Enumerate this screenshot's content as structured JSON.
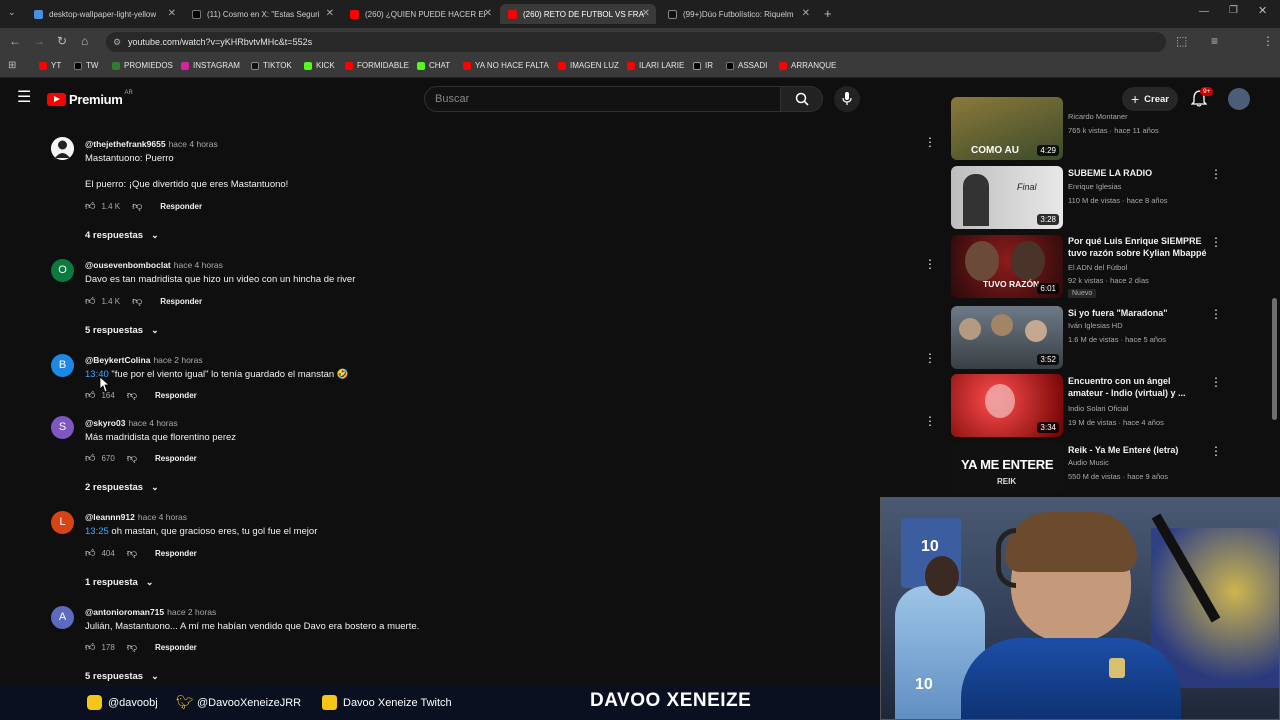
{
  "browser": {
    "tabs": [
      {
        "title": "desktop-wallpaper-light-yellow"
      },
      {
        "title": "(11) Cosmo en X: \"Estas Seguri"
      },
      {
        "title": "(260) ¿QUIEN PUEDE HACER El"
      },
      {
        "title": "(260) RETO DE FUTBOL VS FRA"
      },
      {
        "title": "(99+)Dúo Futbolístico: Riquelm"
      }
    ],
    "url": "youtube.com/watch?v=yKHRbvtvMHc&t=552s",
    "bookmarks": [
      "YT",
      "TW",
      "PROMIEDOS",
      "INSTAGRAM",
      "TIKTOK",
      "KICK",
      "FORMIDABLE",
      "CHAT",
      "YA NO HACE FALTA",
      "IMAGEN LUZ",
      "ILARI LARIE",
      "IR",
      "ASSADI",
      "ARRANQUE"
    ]
  },
  "youtube": {
    "logo": "Premium",
    "region": "AR",
    "search_placeholder": "Buscar",
    "create_label": "Crear",
    "notif_badge": "9+"
  },
  "comments": [
    {
      "author": "@thejethefrank9655",
      "time": "hace 4 horas",
      "avatar_letter": "",
      "avatar_color": "#ffffff",
      "text": "Mastantuono: Puerro",
      "text2": "El puerro: ¡Que divertido que eres Mastantuono!",
      "likes": "1.4 K",
      "reply": "Responder",
      "replies": "4 respuestas"
    },
    {
      "author": "@ousevenbomboclat",
      "time": "hace 4 horas",
      "avatar_letter": "O",
      "avatar_color": "#0b7a3e",
      "text": "Davo es tan madridista que hizo un video con un hincha de river",
      "likes": "1.4 K",
      "reply": "Responder",
      "replies": "5 respuestas"
    },
    {
      "author": "@BeykertColina",
      "time": "hace 2 horas",
      "avatar_letter": "B",
      "avatar_color": "#1e88e5",
      "timestamp": "13:40",
      "text": " \"fue por el viento igual\" lo tenía guardado el manstan 🤣",
      "likes": "164",
      "reply": "Responder"
    },
    {
      "author": "@skyro03",
      "time": "hace 4 horas",
      "avatar_letter": "S",
      "avatar_color": "#7e57c2",
      "text": "Más madridista que florentino perez",
      "likes": "670",
      "reply": "Responder",
      "replies": "2 respuestas"
    },
    {
      "author": "@leannn912",
      "time": "hace 4 horas",
      "avatar_letter": "L",
      "avatar_color": "#d84315",
      "timestamp": "13:25",
      "text": " oh mastan, que gracioso eres, tu gol fue el mejor",
      "likes": "404",
      "reply": "Responder",
      "replies": "1 respuesta"
    },
    {
      "author": "@antonioroman715",
      "time": "hace 2 horas",
      "avatar_letter": "A",
      "avatar_color": "#5c6bc0",
      "text": "Julián, Mastantuono... A mí me habían vendido que Davo era bostero a muerte.",
      "likes": "178",
      "reply": "Responder",
      "replies": "5 respuestas"
    }
  ],
  "sidebar_videos": [
    {
      "title": "",
      "channel": "Ricardo Montaner",
      "meta": "765 k vistas · hace 11 años",
      "duration": "4:29",
      "thumb_text": "COMO AU"
    },
    {
      "title": "SUBEME LA RADIO",
      "channel": "Enrique Iglesias",
      "meta": "110 M de vistas · hace 8 años",
      "duration": "3:28",
      "thumb_text": "Final"
    },
    {
      "title": "Por qué Luis Enrique SIEMPRE tuvo razón sobre Kylian Mbappé",
      "channel": "El ADN del Fútbol",
      "meta": "92 k vistas · hace 2 días",
      "duration": "6:01",
      "badge": "Nuevo",
      "thumb_text": "TUVO RAZÓN"
    },
    {
      "title": "Si yo fuera \"Maradona\"",
      "channel": "Iván Iglesias HD",
      "meta": "1.6 M de vistas · hace 5 años",
      "duration": "3:52",
      "thumb_text": ""
    },
    {
      "title": "Encuentro con un ángel amateur - Indio (virtual) y ...",
      "channel": "Indio Solari Oficial",
      "meta": "19 M de vistas · hace 4 años",
      "duration": "3:34",
      "thumb_text": ""
    },
    {
      "title": "Reik - Ya Me Enteré (letra)",
      "channel": "Audio Music",
      "meta": "550 M de vistas · hace 9 años",
      "duration": "",
      "thumb_text": "YA ME ENTERE",
      "thumb_sub": "REIK"
    }
  ],
  "stream": {
    "instagram": "@davoobj",
    "twitter": "@DavooXeneizeJRR",
    "twitch": "Davoo Xeneize Twitch",
    "brand": "DAVOO XENEIZE",
    "jersey_numbers": [
      "10",
      "10"
    ]
  },
  "colors": {
    "youtube_red": "#ff0000",
    "link_blue": "#3ea6ff",
    "bg": "#0f0f0f"
  }
}
